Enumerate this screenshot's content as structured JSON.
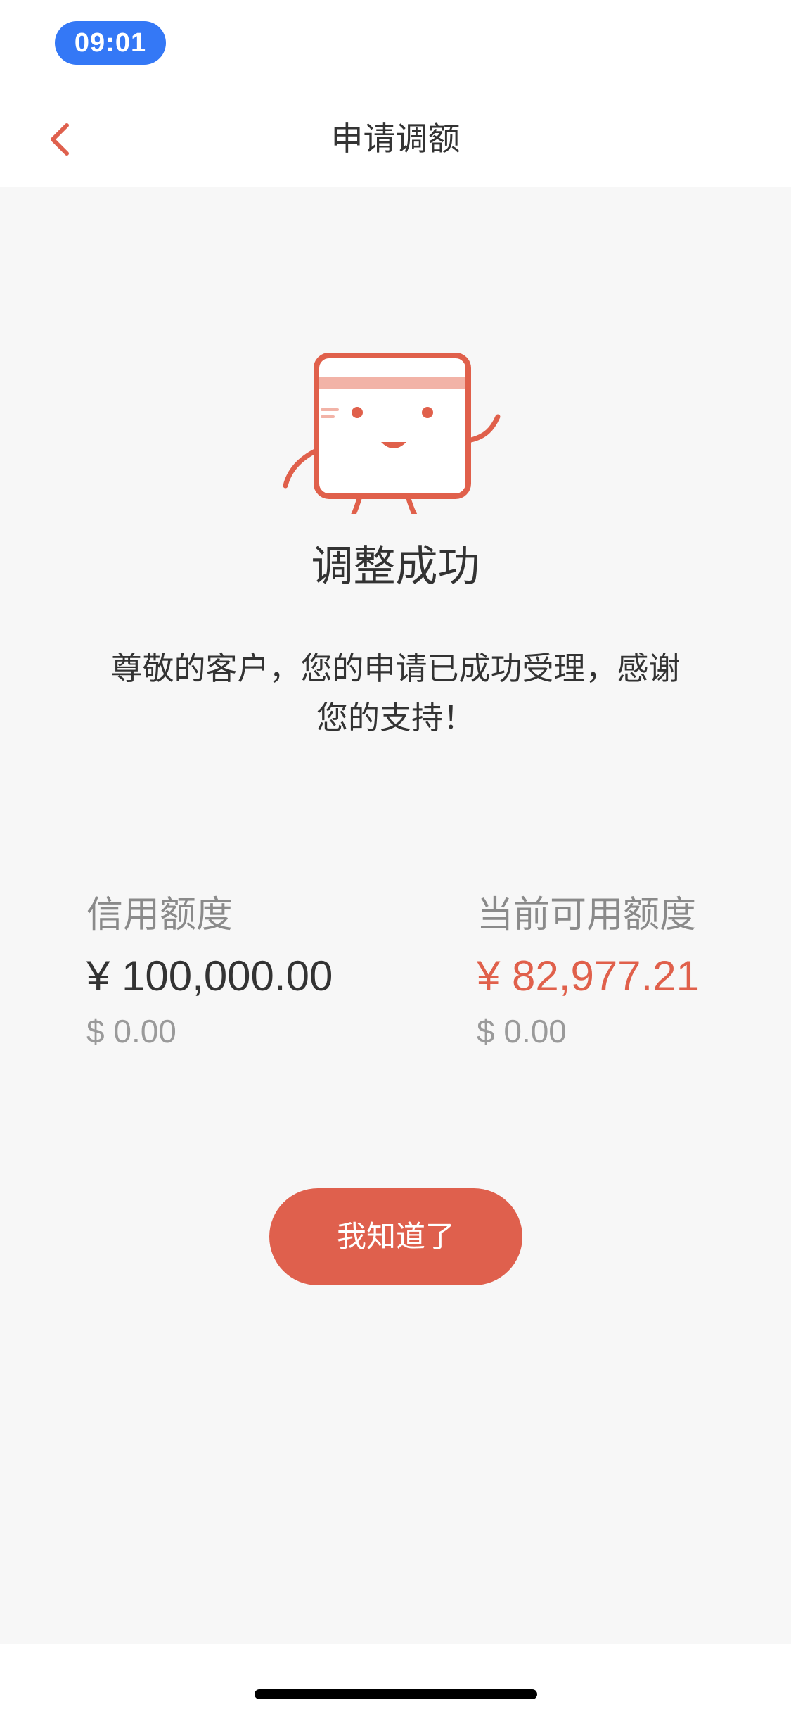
{
  "status_bar": {
    "time": "09:01"
  },
  "nav": {
    "title": "申请调额",
    "back_icon": "chevron-left-icon"
  },
  "result": {
    "icon": "card-mascot-icon",
    "title": "调整成功",
    "message_line1": "尊敬的客户，您的申请已成功受理，感谢",
    "message_line2": "您的支持！"
  },
  "amounts": {
    "credit_limit": {
      "label": "信用额度",
      "cny": "¥ 100,000.00",
      "usd": "$ 0.00"
    },
    "available": {
      "label": "当前可用额度",
      "cny": "¥ 82,977.21",
      "usd": "$ 0.00"
    }
  },
  "actions": {
    "confirm_label": "我知道了"
  },
  "colors": {
    "accent": "#df604d",
    "time_pill": "#3478f6",
    "background": "#f7f7f7"
  }
}
